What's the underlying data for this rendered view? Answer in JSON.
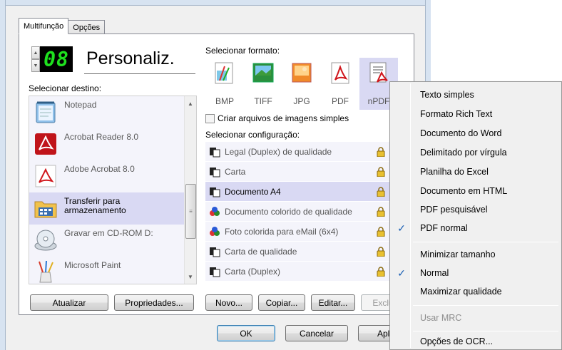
{
  "tabs": [
    {
      "label": "Multifunção",
      "active": true
    },
    {
      "label": "Opções",
      "active": false
    }
  ],
  "counter": {
    "digits": "08",
    "spin_up": "▲",
    "spin_down": "▼"
  },
  "profile_name": "Personaliz.",
  "labels": {
    "select_destination": "Selecionar destino:",
    "select_format": "Selecionar formato:",
    "select_config": "Selecionar configuração:",
    "create_files": "Criar arquivos de imagens simples"
  },
  "destinations": [
    {
      "label": "Notepad",
      "icon": "notepad-icon",
      "selected": false
    },
    {
      "label": "Acrobat Reader 8.0",
      "icon": "acrobat-reader-icon",
      "selected": false
    },
    {
      "label": "Adobe Acrobat 8.0",
      "icon": "adobe-acrobat-icon",
      "selected": false
    },
    {
      "label": "Transferir para\narmazenamento",
      "icon": "storage-folder-icon",
      "selected": true
    },
    {
      "label": "Gravar em CD-ROM  D:",
      "icon": "cdrom-icon",
      "selected": false
    },
    {
      "label": "Microsoft Paint",
      "icon": "paint-icon",
      "selected": false
    }
  ],
  "formats": [
    {
      "label": "BMP",
      "selected": false
    },
    {
      "label": "TIFF",
      "selected": false
    },
    {
      "label": "JPG",
      "selected": false
    },
    {
      "label": "PDF",
      "selected": false
    },
    {
      "label": "nPDF",
      "selected": true
    }
  ],
  "configurations": [
    {
      "label": "Legal (Duplex) de qualidade",
      "icon": "bw-doc-icon",
      "selected": false
    },
    {
      "label": "Carta",
      "icon": "bw-doc-icon",
      "selected": false
    },
    {
      "label": "Documento A4",
      "icon": "bw-doc-icon",
      "selected": true
    },
    {
      "label": "Documento colorido de qualidade",
      "icon": "color-doc-icon",
      "selected": false
    },
    {
      "label": "Foto colorida para eMail (6x4)",
      "icon": "color-doc-icon",
      "selected": false
    },
    {
      "label": "Carta de qualidade",
      "icon": "bw-doc-icon",
      "selected": false
    },
    {
      "label": "Carta (Duplex)",
      "icon": "bw-doc-icon",
      "selected": false
    }
  ],
  "buttons": {
    "refresh": "Atualizar",
    "properties": "Propriedades...",
    "new": "Novo...",
    "copy": "Copiar...",
    "edit": "Editar...",
    "delete": "Exclu",
    "ok": "OK",
    "cancel": "Cancelar",
    "apply": "Aplic"
  },
  "menu": {
    "items": [
      {
        "label": "Texto simples",
        "checked": false,
        "disabled": false
      },
      {
        "label": "Formato Rich Text",
        "checked": false,
        "disabled": false
      },
      {
        "label": "Documento do Word",
        "checked": false,
        "disabled": false
      },
      {
        "label": "Delimitado por vírgula",
        "checked": false,
        "disabled": false
      },
      {
        "label": "Planilha do Excel",
        "checked": false,
        "disabled": false
      },
      {
        "label": "Documento em HTML",
        "checked": false,
        "disabled": false
      },
      {
        "label": "PDF pesquisável",
        "checked": false,
        "disabled": false
      },
      {
        "label": "PDF normal",
        "checked": true,
        "disabled": false
      },
      {
        "label": "Minimizar tamanho",
        "checked": false,
        "disabled": false
      },
      {
        "label": "Normal",
        "checked": true,
        "disabled": false
      },
      {
        "label": "Maximizar qualidade",
        "checked": false,
        "disabled": false
      },
      {
        "label": "Usar MRC",
        "checked": false,
        "disabled": true
      },
      {
        "label": "Opções de OCR...",
        "checked": false,
        "disabled": false
      }
    ],
    "check_glyph": "✓"
  },
  "colors": {
    "selection": "#d9d9f3",
    "list_bg": "#f4f4fb",
    "lcd_digits": "#1ee01e",
    "check": "#1a5fb4"
  }
}
